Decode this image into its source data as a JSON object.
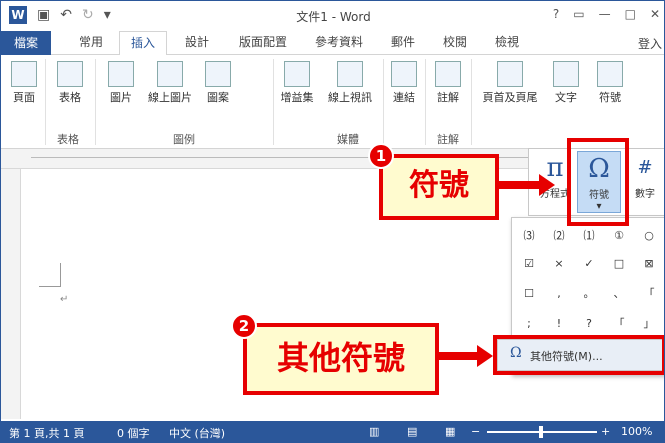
{
  "window": {
    "title": "文件1 - Word",
    "login": "登入"
  },
  "tabs": [
    "檔案",
    "常用",
    "插入",
    "設計",
    "版面配置",
    "參考資料",
    "郵件",
    "校閱",
    "檢視"
  ],
  "ribbon": {
    "buttons": {
      "page": "頁面",
      "table": "表格",
      "picture": "圖片",
      "online_picture": "線上圖片",
      "shapes": "圖案",
      "addins": "增益集",
      "online_video": "線上視訊",
      "link": "連結",
      "comment": "註解",
      "header_footer": "頁首及頁尾",
      "text": "文字",
      "symbol": "符號"
    },
    "groups": {
      "table": "表格",
      "illustrations": "圖例",
      "media": "媒體",
      "comments": "註解"
    }
  },
  "gallery": {
    "equation": "方程式",
    "symbol": "符號",
    "number": "數字"
  },
  "symbol_panel": {
    "cells": [
      "⑶",
      "⑵",
      "⑴",
      "①",
      "○",
      "☑",
      "×",
      "✓",
      "□",
      "⊠",
      "☐",
      ",",
      "。",
      "、",
      "「",
      ";",
      "!",
      "?",
      "「",
      "」"
    ],
    "more": "其他符號(M)..."
  },
  "callouts": {
    "step1_num": "1",
    "step1_text": "符號",
    "step2_num": "2",
    "step2_text": "其他符號"
  },
  "status": {
    "page": "第 1 頁,共 1 頁",
    "words": "0 個字",
    "language": "中文 (台灣)",
    "zoom": "100%"
  },
  "colors": {
    "accent": "#2b579a",
    "callout_red": "#e60000",
    "callout_bg": "#fffbcf"
  }
}
